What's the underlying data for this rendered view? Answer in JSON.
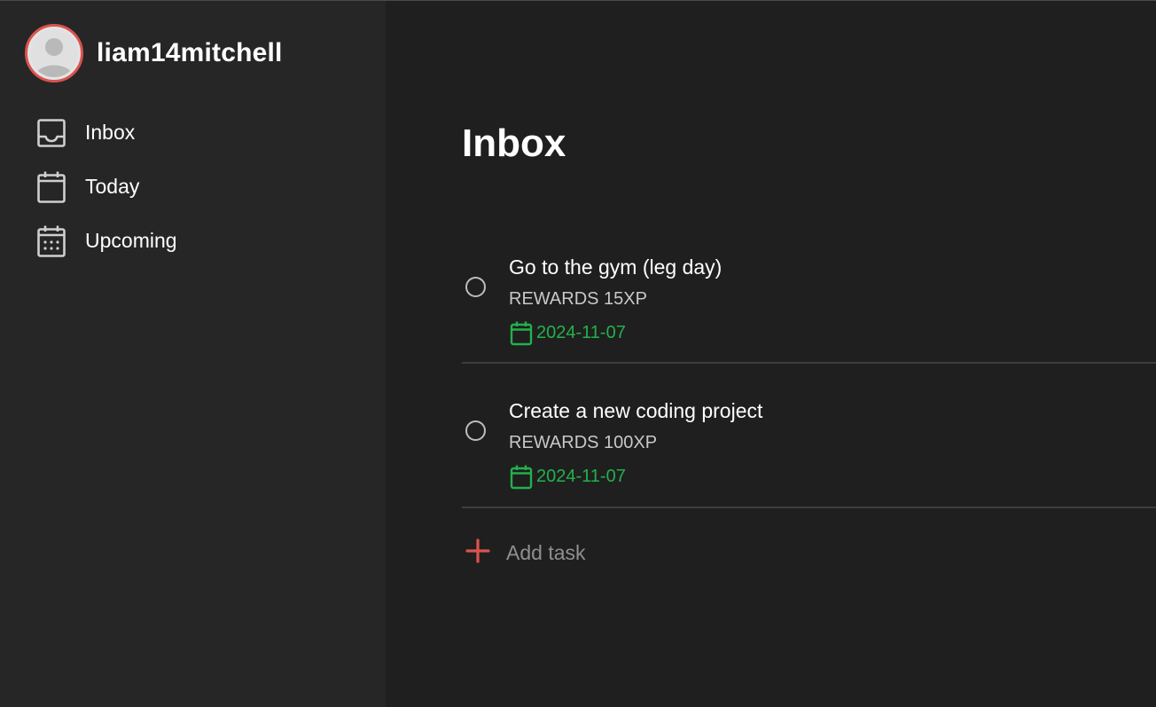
{
  "profile": {
    "username": "liam14mitchell",
    "avatar_icon": "user-placeholder-icon",
    "avatar_ring_color": "#d9534f"
  },
  "sidebar": {
    "items": [
      {
        "label": "Inbox",
        "icon": "inbox-icon"
      },
      {
        "label": "Today",
        "icon": "calendar-icon"
      },
      {
        "label": "Upcoming",
        "icon": "calendar-grid-icon"
      }
    ]
  },
  "main": {
    "title": "Inbox",
    "tasks": [
      {
        "title": "Go to the gym (leg day)",
        "reward": "REWARDS 15XP",
        "date": "2024-11-07",
        "completed": false
      },
      {
        "title": "Create a new coding project",
        "reward": "REWARDS 100XP",
        "date": "2024-11-07",
        "completed": false
      }
    ],
    "add_task_label": "Add task"
  },
  "colors": {
    "accent": "#d9534f",
    "date": "#22b14c",
    "sidebar_bg": "#262626",
    "main_bg": "#1f1f1f"
  }
}
